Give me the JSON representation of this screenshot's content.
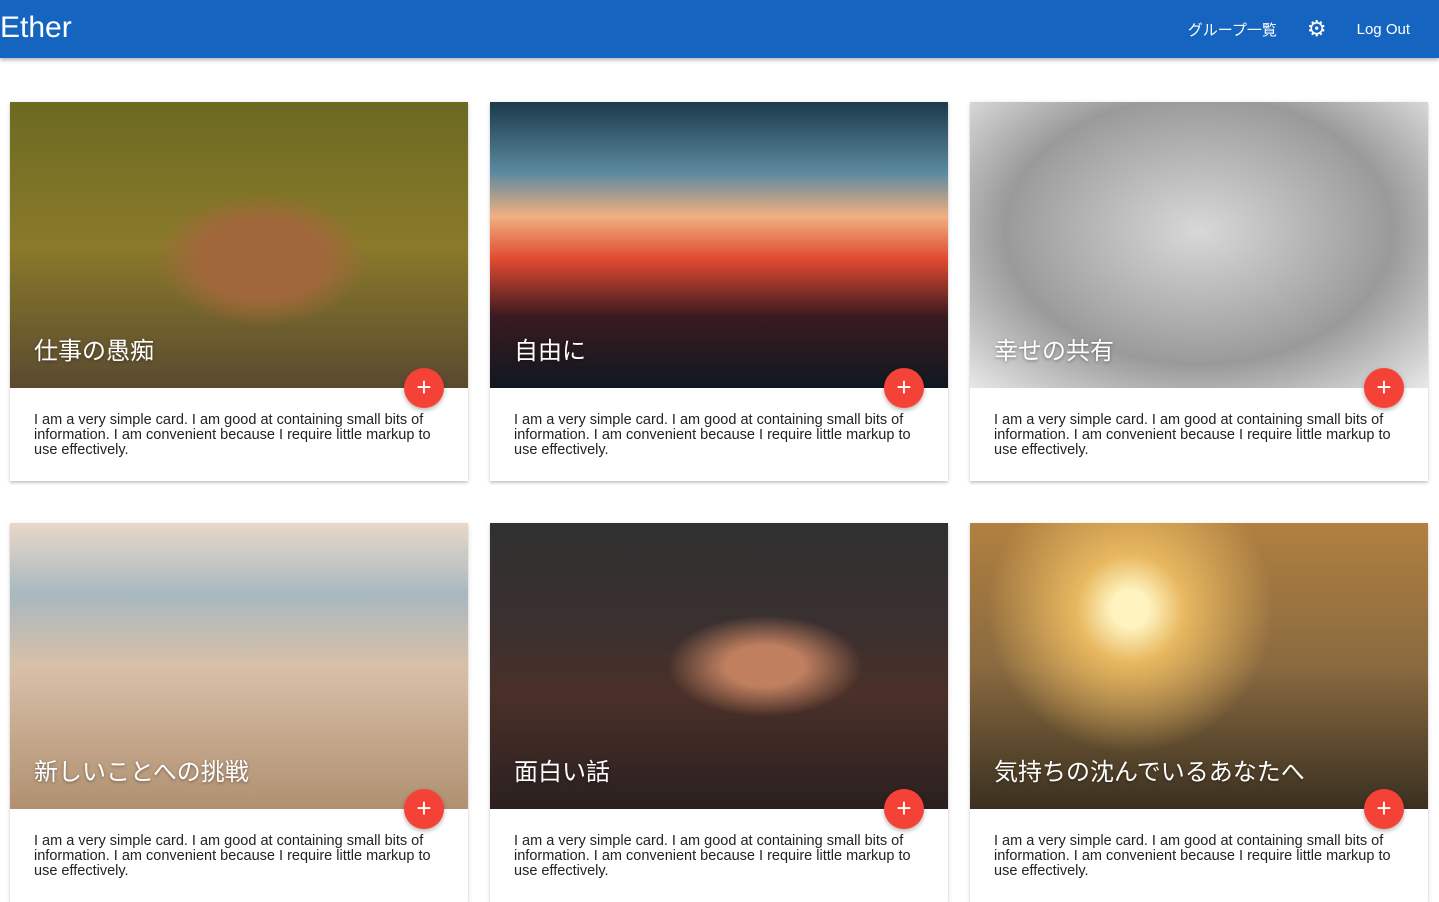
{
  "header": {
    "brand": "Ether",
    "groups_link": "グループ一覧",
    "settings_icon": "gear-icon",
    "logout": "Log Out"
  },
  "card_text": "I am a very simple card. I am good at containing small bits of information. I am convenient because I require little markup to use effectively.",
  "add_label": "+",
  "cards": [
    {
      "title": "仕事の愚痴"
    },
    {
      "title": "自由に"
    },
    {
      "title": "幸せの共有"
    },
    {
      "title": "新しいことへの挑戦"
    },
    {
      "title": "面白い話"
    },
    {
      "title": "気持ちの沈んでいるあなたへ"
    }
  ]
}
